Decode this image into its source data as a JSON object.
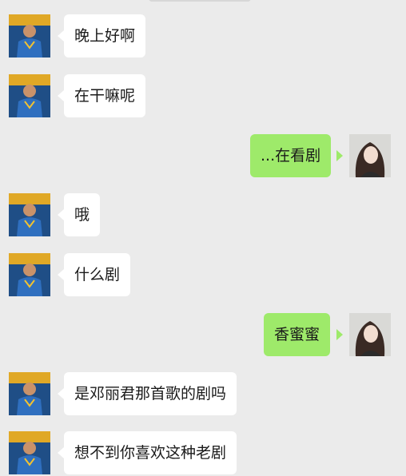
{
  "colors": {
    "background": "#ebebeb",
    "incoming_bubble": "#ffffff",
    "outgoing_bubble": "#9eea6a",
    "text": "#1a1a1a"
  },
  "avatar_icons": {
    "left": "basketball-player-avatar-icon",
    "right": "woman-portrait-avatar-icon"
  },
  "messages": [
    {
      "side": "in",
      "text": "晚上好啊"
    },
    {
      "side": "in",
      "text": "在干嘛呢"
    },
    {
      "side": "out",
      "text": "...在看剧"
    },
    {
      "side": "in",
      "text": "哦"
    },
    {
      "side": "in",
      "text": "什么剧"
    },
    {
      "side": "out",
      "text": "香蜜蜜"
    },
    {
      "side": "in",
      "text": "是邓丽君那首歌的剧吗"
    },
    {
      "side": "in",
      "text": "想不到你喜欢这种老剧"
    }
  ]
}
